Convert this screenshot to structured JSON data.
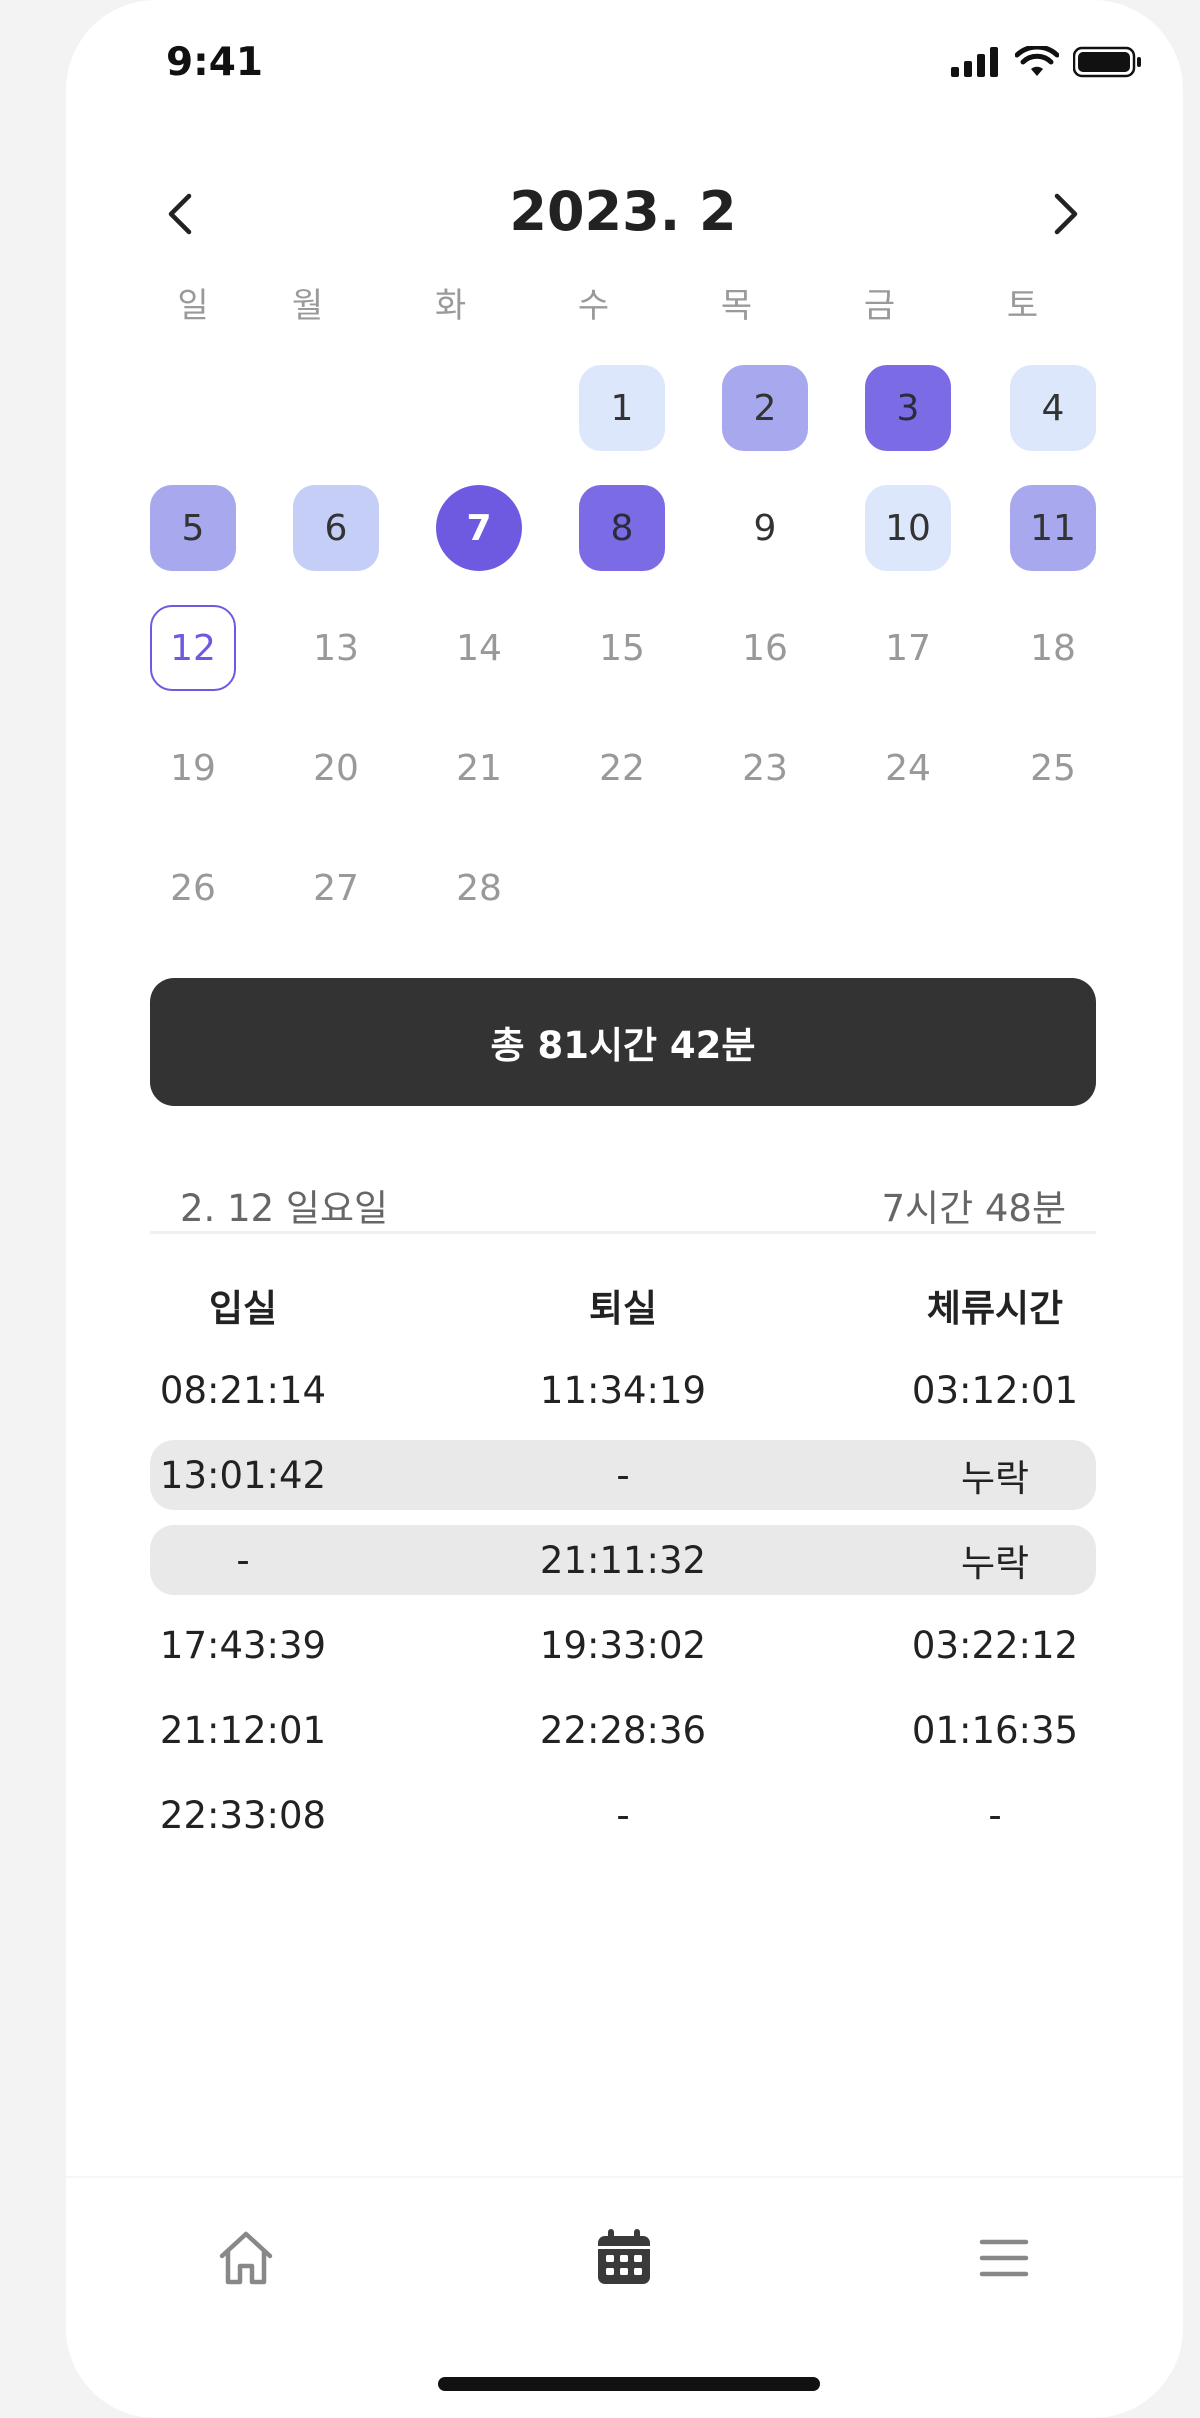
{
  "status_bar": {
    "time": "9:41"
  },
  "calendar": {
    "title": "2023. 2",
    "weekdays": [
      "일",
      "월",
      "화",
      "수",
      "목",
      "금",
      "토"
    ],
    "days": [
      "1",
      "2",
      "3",
      "4",
      "5",
      "6",
      "7",
      "8",
      "9",
      "10",
      "11",
      "12",
      "13",
      "14",
      "15",
      "16",
      "17",
      "18",
      "19",
      "20",
      "21",
      "22",
      "23",
      "24",
      "25",
      "26",
      "27",
      "28"
    ]
  },
  "summary": {
    "total": "총 81시간 42분"
  },
  "selected_day": {
    "date": "2. 12 일요일",
    "duration": "7시간 48분"
  },
  "table": {
    "headers": [
      "입실",
      "퇴실",
      "체류시간"
    ],
    "rows": [
      [
        "08:21:14",
        "11:34:19",
        "03:12:01"
      ],
      [
        "13:01:42",
        "-",
        "누락"
      ],
      [
        "-",
        "21:11:32",
        "누락"
      ],
      [
        "17:43:39",
        "19:33:02",
        "03:22:12"
      ],
      [
        "21:12:01",
        "22:28:36",
        "01:16:35"
      ],
      [
        "22:33:08",
        "-",
        "-"
      ]
    ]
  },
  "colors": {
    "accent": "#6d5ae0",
    "level1": "#dce7fb",
    "level2": "#c4cef6",
    "level3": "#a8a8ee",
    "level4": "#7b6ce6",
    "total_bar": "#333333",
    "missing_row": "#e9e9e9"
  },
  "icons": {
    "prev": "chevron-left-icon",
    "next": "chevron-right-icon",
    "home": "home-icon",
    "calendar": "calendar-icon",
    "menu": "menu-icon"
  }
}
